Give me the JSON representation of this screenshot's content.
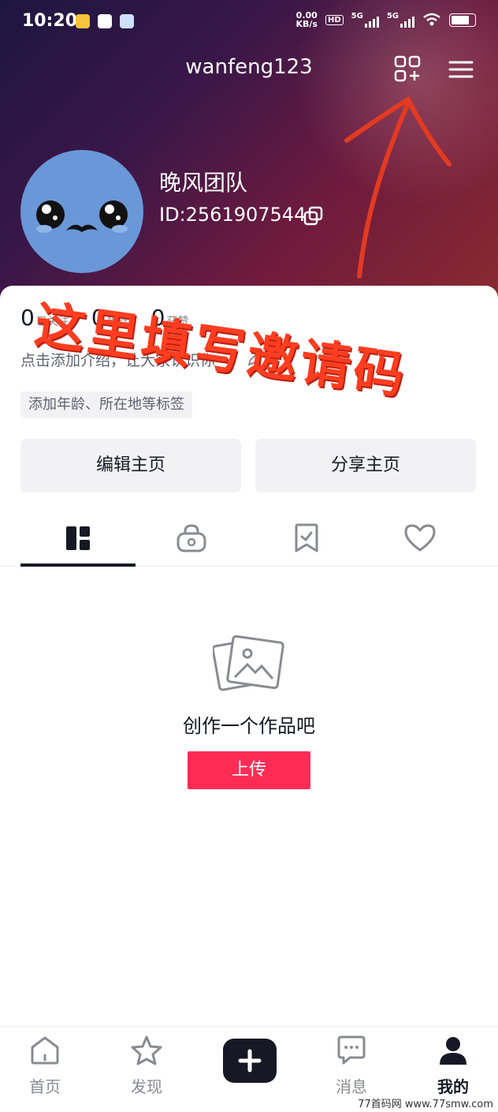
{
  "status_bar": {
    "time": "10:20",
    "net_speed_value": "0.00",
    "net_speed_unit": "KB/s",
    "hd_label": "HD",
    "sim1_label": "5G",
    "sim2_label": "5G"
  },
  "header": {
    "username": "wanfeng123"
  },
  "profile": {
    "nickname": "晚风团队",
    "user_id": "ID:2561907544"
  },
  "stats": [
    {
      "value": "0",
      "label": "已关注"
    },
    {
      "value": "0",
      "label": "粉丝"
    },
    {
      "value": "0",
      "label": "获赞"
    }
  ],
  "bio_prompt": "点击添加介绍，让大家认识你",
  "tag_prompt": "添加年龄、所在地等标签",
  "actions": {
    "edit_label": "编辑主页",
    "share_label": "分享主页"
  },
  "tabs": [
    {
      "icon": "grid-works-icon"
    },
    {
      "icon": "lock-icon"
    },
    {
      "icon": "bookmark-icon"
    },
    {
      "icon": "heart-icon"
    }
  ],
  "empty_state": {
    "text": "创作一个作品吧",
    "button_label": "上传"
  },
  "annotation": {
    "text": "这里填写邀请码",
    "color": "#ff3d20"
  },
  "bottom_nav": [
    {
      "label": "首页",
      "icon": "home-icon"
    },
    {
      "label": "发现",
      "icon": "star-icon"
    },
    {
      "label": "",
      "icon": "plus-icon"
    },
    {
      "label": "消息",
      "icon": "message-icon"
    },
    {
      "label": "我的",
      "icon": "person-icon"
    }
  ],
  "watermark": "77首码网 www.77smw.com",
  "colors": {
    "accent": "#fe2c55",
    "text": "#161823"
  }
}
